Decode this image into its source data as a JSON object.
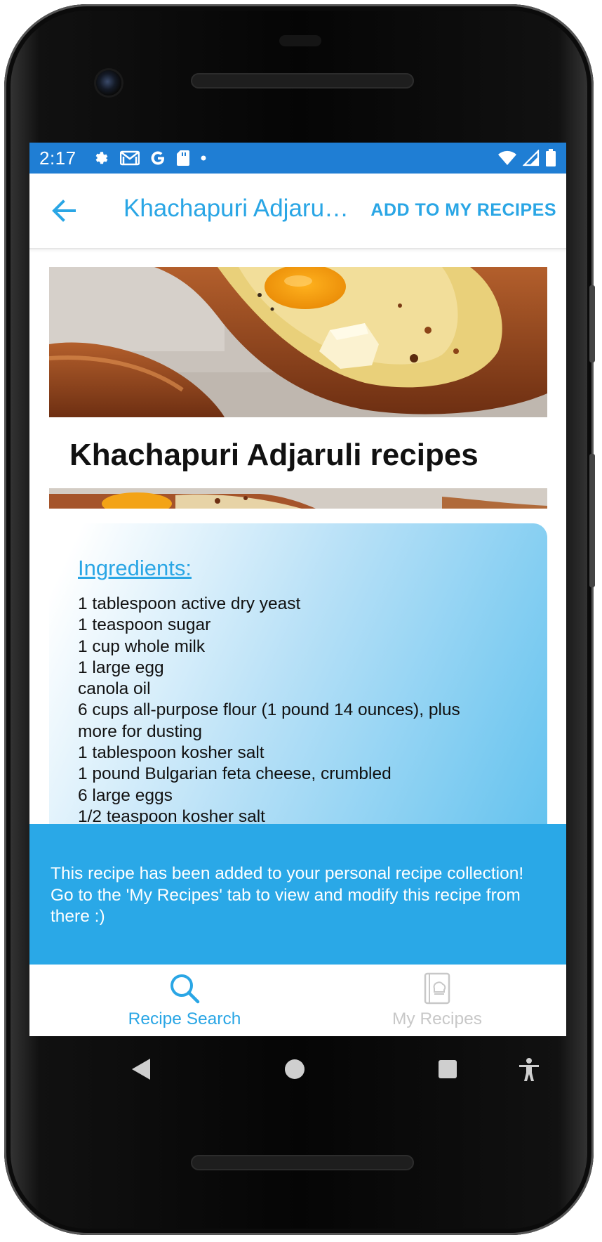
{
  "status_bar": {
    "time": "2:17"
  },
  "app_bar": {
    "title": "Khachapuri Adjaruli recipes",
    "title_display": "Khachapuri Adjaru…",
    "add_button": "ADD TO MY RECIPES"
  },
  "recipe": {
    "title": "Khachapuri Adjaruli recipes",
    "ingredients_heading": "Ingredients:",
    "ingredients": [
      "1 tablespoon active dry yeast",
      "1 teaspoon sugar",
      "1 cup whole milk",
      "1 large egg",
      "canola oil",
      "6 cups all-purpose flour (1 pound 14 ounces), plus more for dusting",
      "1 tablespoon kosher salt",
      "1 pound Bulgarian feta cheese, crumbled",
      "6 large eggs",
      "1/2 teaspoon kosher salt"
    ]
  },
  "snackbar": {
    "message": "This recipe has been added to your personal recipe collection! Go to the 'My Recipes' tab to view and modify this recipe from there :)"
  },
  "bottom_nav": {
    "items": [
      {
        "label": "Recipe Search",
        "icon": "search-icon",
        "active": true
      },
      {
        "label": "My Recipes",
        "icon": "recipe-book-icon",
        "active": false
      }
    ]
  },
  "colors": {
    "accent": "#2aa6e5",
    "status_bar": "#1f7ed4",
    "snackbar": "#2aa8e7",
    "inactive": "#c8c8c8"
  }
}
